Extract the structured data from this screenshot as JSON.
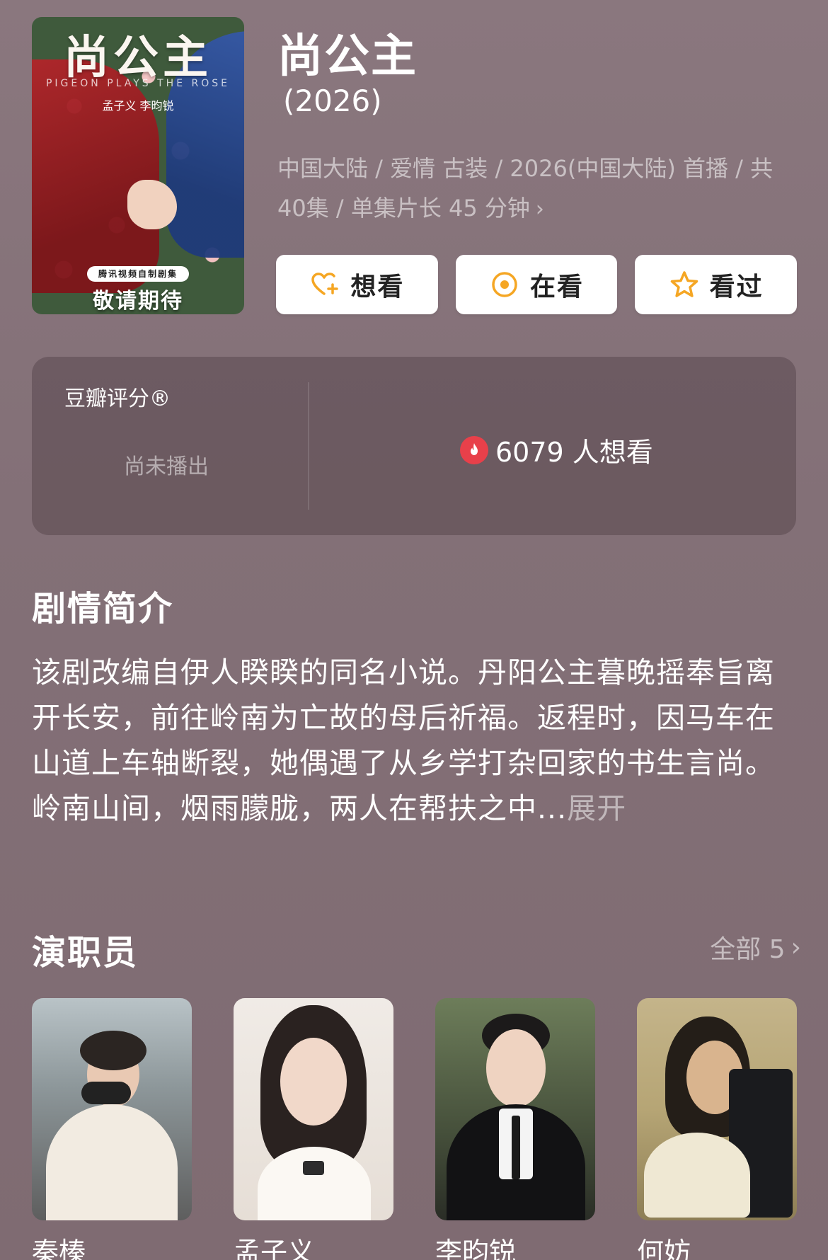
{
  "show": {
    "title": "尚公主",
    "year": "(2026)",
    "meta_line1": "中国大陆 / 爱情 古装 / 2026(中国大陆) 首播 / 共",
    "meta_line2": "40集 / 单集片长 45 分钟",
    "poster": {
      "title": "尚公主",
      "subtitle": "PIGEON PLAYS THE ROSE",
      "names": "孟子义 李昀锐",
      "tag": "腾讯视频自制剧集",
      "coming": "敬请期待"
    }
  },
  "actions": [
    {
      "label": "想看",
      "icon": "heart-plus-icon"
    },
    {
      "label": "在看",
      "icon": "target-circle-icon"
    },
    {
      "label": "看过",
      "icon": "star-icon"
    }
  ],
  "rating": {
    "label": "豆瓣评分®",
    "status": "尚未播出",
    "want_text": "6079 人想看"
  },
  "synopsis": {
    "heading": "剧情简介",
    "text": "该剧改编自伊人睽睽的同名小说。丹阳公主暮晚摇奉旨离开长安，前往岭南为亡故的母后祈福。返程时，因马车在山道上车轴断裂，她偶遇了从乡学打杂回家的书生言尚。岭南山间，烟雨朦胧，两人在帮扶之中...",
    "more": "展开"
  },
  "cast": {
    "heading": "演职员",
    "all_label": "全部 5",
    "members": [
      {
        "name": "秦榛"
      },
      {
        "name": "孟子义"
      },
      {
        "name": "李昀锐"
      },
      {
        "name": "何妨"
      }
    ]
  },
  "colors": {
    "background": "#86737b",
    "action_accent": "#f5a623",
    "fire": "#e8404a"
  }
}
